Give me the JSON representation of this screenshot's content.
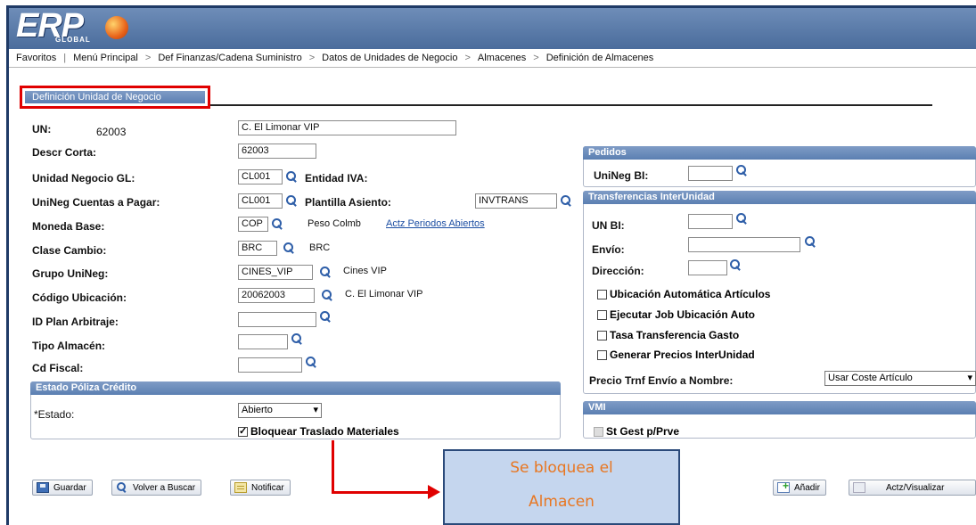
{
  "app": {
    "logo_text": "ERP",
    "logo_sub": "GLOBAL"
  },
  "nav": [
    "Favoritos",
    "Menú Principal",
    "Def Finanzas/Cadena Suministro",
    "Datos de Unidades de Negocio",
    "Almacenes",
    "Definición de Almacenes"
  ],
  "nav_sep": ">",
  "tab": {
    "label": "Definición Unidad de Negocio"
  },
  "form": {
    "un_label": "UN:",
    "un_value": "62003",
    "descr_value": "C. El Limonar VIP",
    "descr_corta_label": "Descr Corta:",
    "descr_corta_value": "62003",
    "unidad_gl_label": "Unidad Negocio GL:",
    "unidad_gl_value": "CL001",
    "entidad_iva_label": "Entidad IVA:",
    "cuentas_pagar_label": "UniNeg Cuentas a Pagar:",
    "cuentas_pagar_value": "CL001",
    "plantilla_label": "Plantilla Asiento:",
    "plantilla_value": "INVTRANS",
    "moneda_label": "Moneda Base:",
    "moneda_value": "COP",
    "moneda_desc": "Peso Colmb",
    "actz_link": "Actz Periodos Abiertos",
    "clase_label": "Clase Cambio:",
    "clase_value": "BRC",
    "clase_desc": "BRC",
    "grupo_label": "Grupo UniNeg:",
    "grupo_value": "CINES_VIP",
    "grupo_desc": "Cines VIP",
    "codigo_label": "Código Ubicación:",
    "codigo_value": "20062003",
    "codigo_desc": "C. El Limonar VIP",
    "plan_label": "ID Plan Arbitraje:",
    "plan_value": "",
    "tipo_label": "Tipo Almacén:",
    "tipo_value": "",
    "cd_label": "Cd Fiscal:",
    "cd_value": ""
  },
  "estado_section": {
    "header": "Estado Póliza Crédito",
    "estado_label": "*Estado:",
    "estado_value": "Abierto",
    "bloquear_label": "Bloquear Traslado Materiales",
    "bloquear_checked": true
  },
  "pedidos": {
    "header": "Pedidos",
    "unineg_bi_label": "UniNeg BI:",
    "unineg_bi_value": ""
  },
  "transferencias": {
    "header": "Transferencias InterUnidad",
    "un_bi_label": "UN BI:",
    "un_bi_value": "",
    "envio_label": "Envío:",
    "envio_value": "",
    "direccion_label": "Dirección:",
    "direccion_value": "",
    "checks": [
      "Ubicación Automática Artículos",
      "Ejecutar Job Ubicación Auto",
      "Tasa Transferencia Gasto",
      "Generar Precios InterUnidad"
    ],
    "precio_label": "Precio Trnf Envío a Nombre:",
    "precio_value": "Usar Coste Artículo"
  },
  "vmi": {
    "header": "VMI",
    "st_gest_label": "St Gest p/Prve"
  },
  "buttons": {
    "guardar": "Guardar",
    "volver": "Volver a Buscar",
    "notificar": "Notificar",
    "anadir": "Añadir",
    "actz": "Actz/Visualizar"
  },
  "callout": {
    "line1": "Se bloquea el",
    "line2": "Almacen"
  },
  "colors": {
    "accent": "#5b7fb2",
    "highlight": "#e00000",
    "callout_text": "#e87722"
  }
}
